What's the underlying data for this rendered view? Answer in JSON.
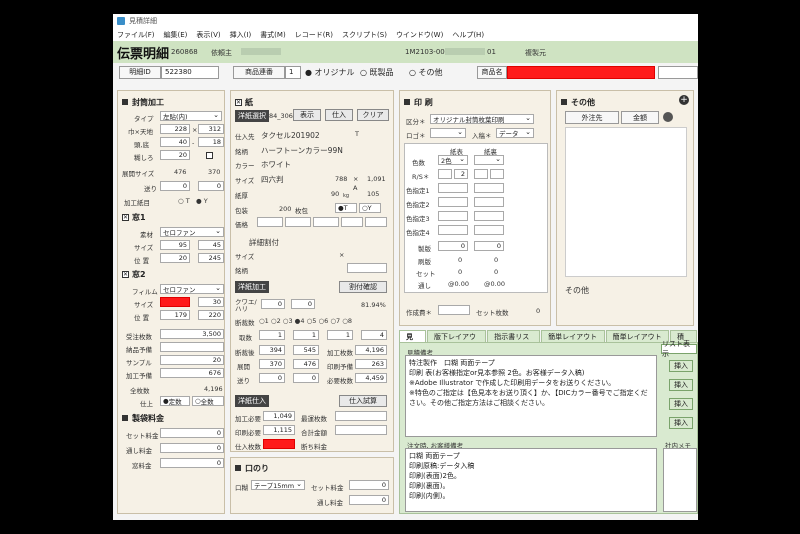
{
  "window": {
    "title": "見積詳細"
  },
  "menu": [
    "ファイル(F)",
    "編集(E)",
    "表示(V)",
    "挿入(I)",
    "書式(M)",
    "レコード(R)",
    "スクリプト(S)",
    "ウインドウ(W)",
    "ヘルプ(H)"
  ],
  "header": {
    "title": "伝票明細",
    "number": "260868",
    "client_label": "依頼主",
    "order_no": "1M2103-00",
    "order_suffix": "01",
    "dup_label": "複製元"
  },
  "info": {
    "detail_id_label": "明細ID",
    "detail_id": "522380",
    "product_no_label": "商品連番",
    "product_no": "1",
    "opt_original": "オリジナル",
    "opt_ready": "既製品",
    "opt_other": "その他",
    "product_name_label": "商品名"
  },
  "left": {
    "envelope_title": "封筒加工",
    "type_label": "タイプ",
    "type_value": "左貼(内)",
    "width_label": "巾×天地",
    "width": "228",
    "height": "312",
    "gusset_label": "頭,底",
    "gusset1": "40",
    "gusset2": "18",
    "flap_label": "糊しろ",
    "flap": "20",
    "unfold_label": "展開サイズ",
    "unfold_w": "476",
    "unfold_h": "370",
    "send_label": "送り",
    "send1": "0",
    "send2": "0",
    "paper_dir_label": "加工紙目",
    "t_label": "T",
    "y_label": "Y",
    "window1_title": "窓1",
    "material_label": "素材",
    "material_value": "セロファン",
    "size_label": "サイズ",
    "w1_size1": "95",
    "w1_size2": "45",
    "pos_label": "位 置",
    "w1_pos1": "20",
    "w1_pos2": "245",
    "window2_title": "窓2",
    "film_label": "フィルム",
    "film_value": "セロファン",
    "w2_size2": "30",
    "w2_pos1": "179",
    "w2_pos2": "220",
    "order_qty_label": "受注枚数",
    "order_qty": "3,500",
    "delivery_label": "納品予備",
    "delivery": "",
    "sample_label": "サンプル",
    "sample": "20",
    "process_label": "加工予備",
    "process": "676",
    "total_label": "全枚数",
    "total": "4,196",
    "finish_label": "仕上",
    "fixed_label": "定数",
    "all_label": "全数",
    "fee_title": "製袋料金",
    "set_fee_label": "セット料金",
    "set_fee": "0",
    "pass_fee_label": "通し料金",
    "pass_fee": "0",
    "window_fee_label": "窓料金",
    "window_fee": "0"
  },
  "paper": {
    "title": "紙",
    "select_label": "洋紙選択",
    "select_code": "84_306",
    "view_btn": "表示",
    "buy_btn": "仕入",
    "clear_btn": "クリア",
    "supplier_label": "仕入先",
    "supplier": "タクセル201902",
    "supplier_t": "T",
    "brand_label": "銘柄",
    "brand": "ハーフトーンカラー99N",
    "color_label": "カラー",
    "color": "ホワイト",
    "size_label": "サイズ",
    "size": "四六判",
    "size_w": "788",
    "size_h": "1,091",
    "size_a": "A",
    "thick_label": "紙厚",
    "thick": "90",
    "kg": "kg",
    "thick2": "105",
    "pack_label": "包装",
    "pack": "200",
    "pack_unit": "枚包",
    "t": "T",
    "y": "Y",
    "price_label": "価格",
    "detail_label": "詳細割付",
    "d_size_label": "サイズ",
    "d_x": "×",
    "d_brand_label": "銘柄",
    "sheet_label": "洋紙加工",
    "cut_confirm": "割付確認",
    "quad_label": "クワエ/ハリ",
    "quad1": "0",
    "quad2": "0",
    "pct": "81.94%",
    "cut_count_label": "断裁数",
    "radio_nums": [
      "1",
      "2",
      "3",
      "4",
      "5",
      "6",
      "7",
      "8"
    ],
    "take_label": "取数",
    "take1": "1",
    "take2": "1",
    "take3": "4",
    "cut_size_label": "断裁後",
    "cut1": "394",
    "cut2": "545",
    "work_qty_label": "加工枚数",
    "work_qty": "4,196",
    "unfold_label": "展開",
    "unfold1": "370",
    "unfold2": "476",
    "print_pre_label": "印刷予備",
    "print_pre": "263",
    "send_label": "送り",
    "send1": "0",
    "send2": "0",
    "need_qty_label": "必要枚数",
    "need_qty": "4,459",
    "buy_title": "洋紙仕入",
    "buy_calc": "仕入試算",
    "need_label": "加工必要",
    "need": "1,049",
    "min_fee_label": "最運枚数",
    "print_need_label": "印刷必要",
    "print_need": "1,115",
    "total_fee_label": "合計金額",
    "buy_qty_label": "仕入枚数",
    "cut_fee_label": "断ち料金"
  },
  "glue": {
    "title": "口のり",
    "mouth_label": "口糊",
    "tape": "テープ15mm",
    "set_fee_label": "セット料金",
    "set_fee": "0",
    "pass_fee_label": "通し料金",
    "pass_fee": "0"
  },
  "print": {
    "title": "印 刷",
    "class_label": "区分＊",
    "class_value": "オリジナル封筒枚葉印刷",
    "logo_label": "ロゴ＊",
    "entry_label": "入稿＊",
    "entry_value": "データ",
    "front_label": "紙表",
    "back_label": "紙裏",
    "colors_label": "色数",
    "colors_value": "2色",
    "rs_label": "R/S＊",
    "rs_value": "2",
    "spec_labels": [
      "色指定1",
      "色指定2",
      "色指定3",
      "色指定4"
    ],
    "plate_label": "製版",
    "plate_front": "0",
    "plate_back": "0",
    "print_count_label": "刷版",
    "print_front": "0",
    "print_back": "0",
    "set_label": "セット",
    "set_front": "0",
    "set_back": "0",
    "pass_label": "通し",
    "pass_front": "@0.00",
    "pass_back": "@0.00",
    "made_label": "作成費＊",
    "set_count_label": "セット枚数",
    "set_count": "0"
  },
  "other": {
    "title": "その他",
    "col1": "外注先",
    "col2": "金額",
    "footer": "その他"
  },
  "tabs": [
    "見積",
    "版下レイアウト",
    "指示書リスト",
    "簡単レイアウト1",
    "簡単レイアウト2",
    "積版"
  ],
  "notes": {
    "remark_label": "見積備考",
    "remark": "特注製作　口糊 両面テープ\n印刷 表(お客様指定or見本参照 2色。お客様データ入稿)\n※Adobe Illustrator で作成した印刷用データをお送りください。\n※特色のご指定は【色見本をお送り頂く】か、【DICカラー番号でご指定ください。その他ご指定方法はご相談ください。",
    "order_label": "注文時, お客様備考",
    "order": "口糊 両面テープ\n印刷原稿:データ入稿\n印刷(表面)2色。\n印刷(裏面)。\n印刷(内側)。",
    "list_btn": "リスト表示",
    "insert_btn": "挿入",
    "memo_label": "社内メモ"
  }
}
